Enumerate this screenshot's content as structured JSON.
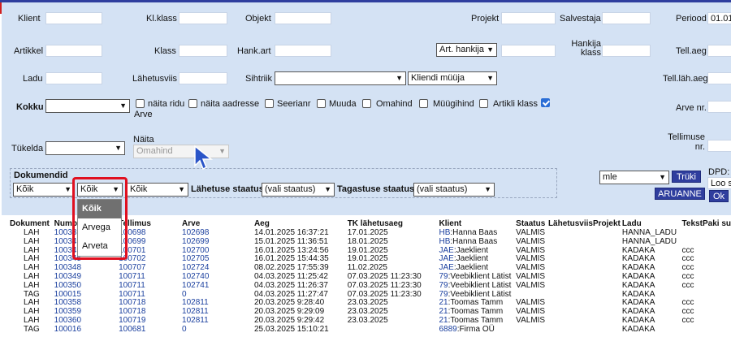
{
  "filters": {
    "klient_label": "Klient",
    "klklass_label": "Kl.klass",
    "objekt_label": "Objekt",
    "projekt_label": "Projekt",
    "salvestaja_label": "Salvestaja",
    "periood_label": "Periood",
    "periood_value": "01.01",
    "artikkel_label": "Artikkel",
    "klass_label": "Klass",
    "hankart_label": "Hank.art",
    "art_hankija_option": "Art. hankija",
    "hankija_klass_label1": "Hankija",
    "hankija_klass_label2": "klass",
    "tellaeg_label": "Tell.aeg",
    "ladu_label": "Ladu",
    "lahetusviis_label": "Lähetusviis",
    "sihtriik_label": "Sihtriik",
    "kliendi_muuja_option": "Kliendi müüja",
    "tell_lah_aeg_label": "Tell.läh.aeg",
    "kokku_label": "Kokku",
    "check_naita_ridu": "näita ridu",
    "check_arve": "Arve",
    "check_naita_aadresse": "näita aadresse",
    "check_seerianr": "Seerianr",
    "check_muuda": "Muuda",
    "check_omahind": "Omahind",
    "check_muugihind": "Müügihind",
    "check_artikli_klass": "Artikli klass",
    "arve_nr_label": "Arve nr.",
    "tukelda_label": "Tükelda",
    "naita_label": "Näita",
    "naita_value": "Omahind",
    "tellimuse_nr_label1": "Tellimuse",
    "tellimuse_nr_label2": "nr.",
    "dokumendid_label": "Dokumendid",
    "dok_select1": "Kõik",
    "dok_select2": "Kõik",
    "dok_select3": "Kõik",
    "lahetuse_staatus_label": "Lähetuse staatus",
    "lahetuse_staatus_value": "(vali staatus)",
    "tagastuse_staatus_label": "Tagastuse staatus",
    "tagastuse_staatus_value": "(vali staatus)",
    "print_select": "mle",
    "trüki_button": "Trüki",
    "aruanne_button": "ARUANNE",
    "ok_button": "Ok",
    "dpd_label": "DPD:",
    "dpd_value": "Loo s"
  },
  "dropdown": {
    "options": [
      "Kõik",
      "Arvega",
      "Arveta"
    ],
    "selected": "Kõik"
  },
  "table": {
    "columns": [
      "Dokument",
      "Numbr",
      "Tellimus",
      "Arve",
      "Aeg",
      "TK lähetusaeg",
      "Klient",
      "Staatus",
      "Lähetusviis",
      "Projekt",
      "Ladu",
      "Tekst",
      "Paki su"
    ],
    "rows": [
      {
        "dok": "LAH",
        "nr": "10033",
        "tell": "100698",
        "arve": "102698",
        "aeg": "14.01.2025 16:37:21",
        "tk": "17.01.2025",
        "kl_code": "HB",
        "kl_name": "Hanna Baas",
        "staatus": "VALMIS",
        "ladu": "HANNA_LADU",
        "tekst": ""
      },
      {
        "dok": "LAH",
        "nr": "10034",
        "tell": "100699",
        "arve": "102699",
        "aeg": "15.01.2025 11:36:51",
        "tk": "18.01.2025",
        "kl_code": "HB",
        "kl_name": "Hanna Baas",
        "staatus": "VALMIS",
        "ladu": "HANNA_LADU",
        "tekst": ""
      },
      {
        "dok": "LAH",
        "nr": "10034",
        "tell": "100701",
        "arve": "102700",
        "aeg": "16.01.2025 13:24:56",
        "tk": "19.01.2025",
        "kl_code": "JAE",
        "kl_name": "Jaeklient",
        "staatus": "VALMIS",
        "ladu": "KADAKA",
        "tekst": "ccc"
      },
      {
        "dok": "LAH",
        "nr": "100345",
        "tell": "100702",
        "arve": "102705",
        "aeg": "16.01.2025 15:44:35",
        "tk": "19.01.2025",
        "kl_code": "JAE",
        "kl_name": "Jaeklient",
        "staatus": "VALMIS",
        "ladu": "KADAKA",
        "tekst": "ccc"
      },
      {
        "dok": "LAH",
        "nr": "100348",
        "tell": "100707",
        "arve": "102724",
        "aeg": "08.02.2025 17:55:39",
        "tk": "11.02.2025",
        "kl_code": "JAE",
        "kl_name": "Jaeklient",
        "staatus": "VALMIS",
        "ladu": "KADAKA",
        "tekst": "ccc"
      },
      {
        "dok": "LAH",
        "nr": "100349",
        "tell": "100711",
        "arve": "102740",
        "aeg": "04.03.2025 11:25:42",
        "tk": "07.03.2025 11:23:30",
        "kl_code": "79",
        "kl_name": "Veebiklient Lätist",
        "staatus": "VALMIS",
        "ladu": "KADAKA",
        "tekst": "ccc"
      },
      {
        "dok": "LAH",
        "nr": "100350",
        "tell": "100711",
        "arve": "102741",
        "aeg": "04.03.2025 11:26:37",
        "tk": "07.03.2025 11:23:30",
        "kl_code": "79",
        "kl_name": "Veebiklient Lätist",
        "staatus": "VALMIS",
        "ladu": "KADAKA",
        "tekst": "ccc"
      },
      {
        "dok": "TAG",
        "nr": "100015",
        "tell": "100711",
        "arve": "0",
        "aeg": "04.03.2025 11:27:47",
        "tk": "07.03.2025 11:23:30",
        "kl_code": "79",
        "kl_name": "Veebiklient Lätist",
        "staatus": "",
        "ladu": "KADAKA",
        "tekst": ""
      },
      {
        "dok": "LAH",
        "nr": "100358",
        "tell": "100718",
        "arve": "102811",
        "aeg": "20.03.2025 9:28:40",
        "tk": "23.03.2025",
        "kl_code": "21",
        "kl_name": "Toomas Tamm",
        "staatus": "VALMIS",
        "ladu": "KADAKA",
        "tekst": "ccc"
      },
      {
        "dok": "LAH",
        "nr": "100359",
        "tell": "100718",
        "arve": "102811",
        "aeg": "20.03.2025 9:29:09",
        "tk": "23.03.2025",
        "kl_code": "21",
        "kl_name": "Toomas Tamm",
        "staatus": "VALMIS",
        "ladu": "KADAKA",
        "tekst": "ccc"
      },
      {
        "dok": "LAH",
        "nr": "100360",
        "tell": "100719",
        "arve": "102811",
        "aeg": "20.03.2025 9:29:42",
        "tk": "23.03.2025",
        "kl_code": "21",
        "kl_name": "Toomas Tamm",
        "staatus": "VALMIS",
        "ladu": "KADAKA",
        "tekst": "ccc"
      },
      {
        "dok": "TAG",
        "nr": "100016",
        "tell": "100681",
        "arve": "0",
        "aeg": "25.03.2025 15:10:21",
        "tk": "",
        "kl_code": "6889",
        "kl_name": "Firma OÜ",
        "staatus": "",
        "ladu": "KADAKA",
        "tekst": ""
      }
    ]
  },
  "colors": {
    "filter_bg": "#d4e2f4",
    "button_bg": "#2f3e9e",
    "link": "#1a3f9e",
    "highlight": "#e01020"
  }
}
